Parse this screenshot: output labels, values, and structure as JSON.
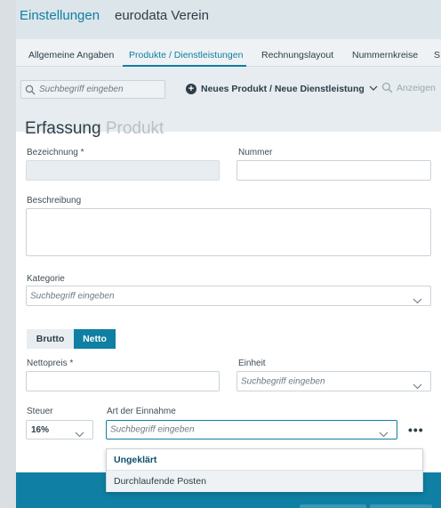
{
  "header": {
    "app_title": "Einstellungen",
    "organization": "eurodata Verein"
  },
  "tabs": [
    {
      "label": "Allgemeine Angaben",
      "active": false
    },
    {
      "label": "Produkte / Dienstleistungen",
      "active": true
    },
    {
      "label": "Rechnungslayout",
      "active": false
    },
    {
      "label": "Nummernkreise",
      "active": false
    },
    {
      "label": "S",
      "active": false
    }
  ],
  "toolbar": {
    "search_placeholder": "Suchbegriff eingeben",
    "new_button_label": "Neues Produkt / Neue Dienstleistung",
    "show_button_label": "Anzeigen"
  },
  "form": {
    "title": "Erfassung",
    "title_sub": "Produkt",
    "bezeichnung_label": "Bezeichnung *",
    "nummer_label": "Nummer",
    "beschreibung_label": "Beschreibung",
    "kategorie_label": "Kategorie",
    "kategorie_placeholder": "Suchbegriff eingeben",
    "brutto_label": "Brutto",
    "netto_label": "Netto",
    "nettopreis_label": "Nettopreis *",
    "einheit_label": "Einheit",
    "einheit_placeholder": "Suchbegriff eingeben",
    "steuer_label": "Steuer",
    "steuer_value": "16%",
    "art_label": "Art der Einnahme",
    "art_placeholder": "Suchbegriff eingeben"
  },
  "dropdown": {
    "options": [
      "Ungeklärt",
      "Durchlaufende Posten"
    ]
  },
  "colors": {
    "accent": "#0f7fa3",
    "text": "#2d3d47",
    "panel": "#ffffff"
  }
}
